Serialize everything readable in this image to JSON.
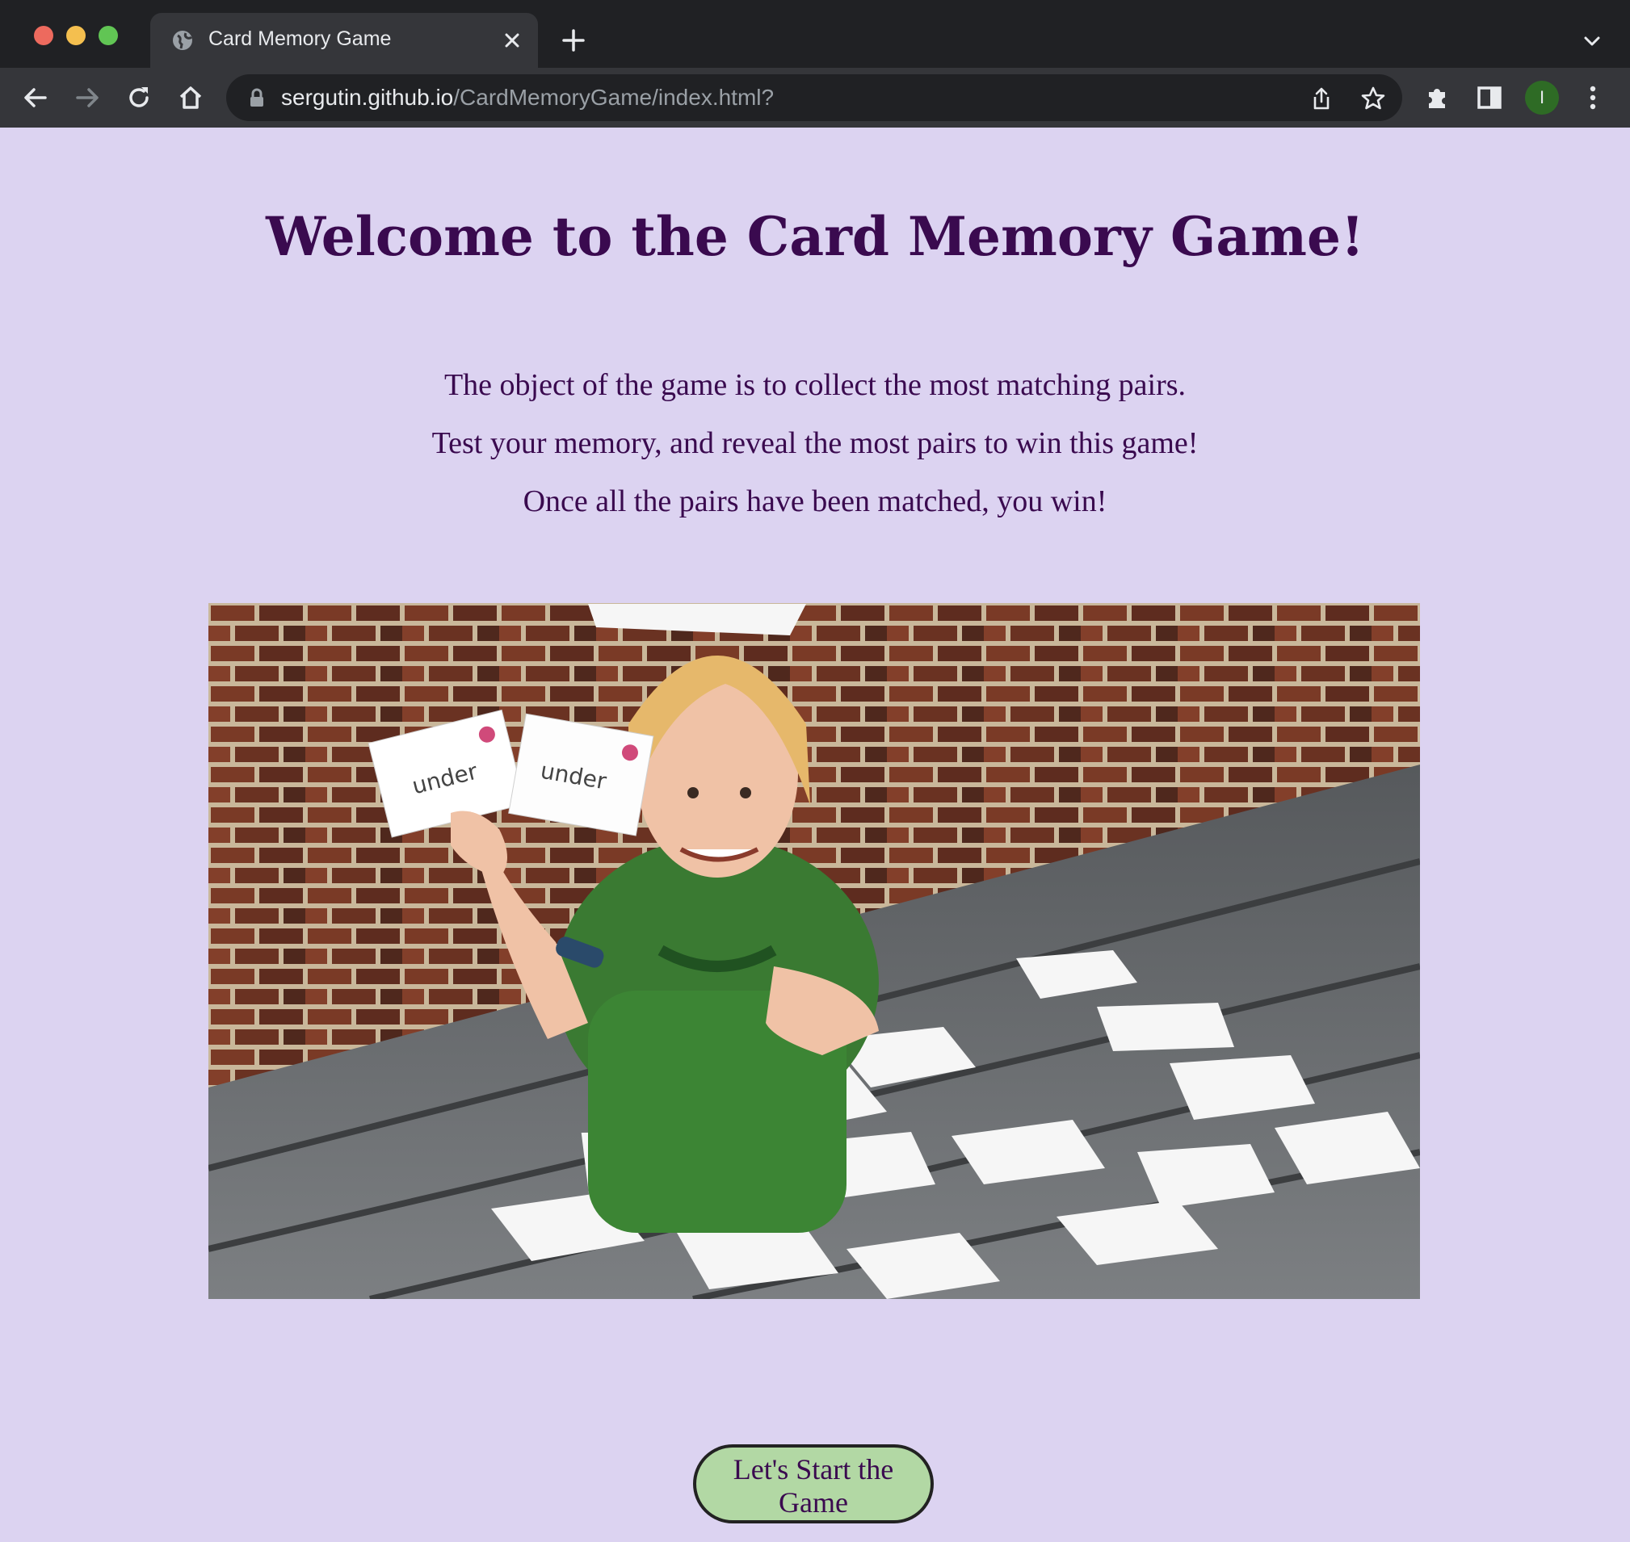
{
  "browser": {
    "tab_title": "Card Memory Game",
    "url_host": "sergutin.github.io",
    "url_path": "/CardMemoryGame/index.html?",
    "profile_initial": "I"
  },
  "page": {
    "title": "Welcome to the Card Memory Game!",
    "intro_lines": [
      "The object of the game is to collect the most matching pairs.",
      "Test your memory, and reveal the most pairs to win this game!",
      "Once all the pairs have been matched, you win!"
    ],
    "hero_card_text": "under",
    "start_button_label": "Let's Start the Game"
  },
  "colors": {
    "page_background": "#dcd3f1",
    "heading_text": "#3a0a4f",
    "button_fill": "#b2d8a4"
  }
}
